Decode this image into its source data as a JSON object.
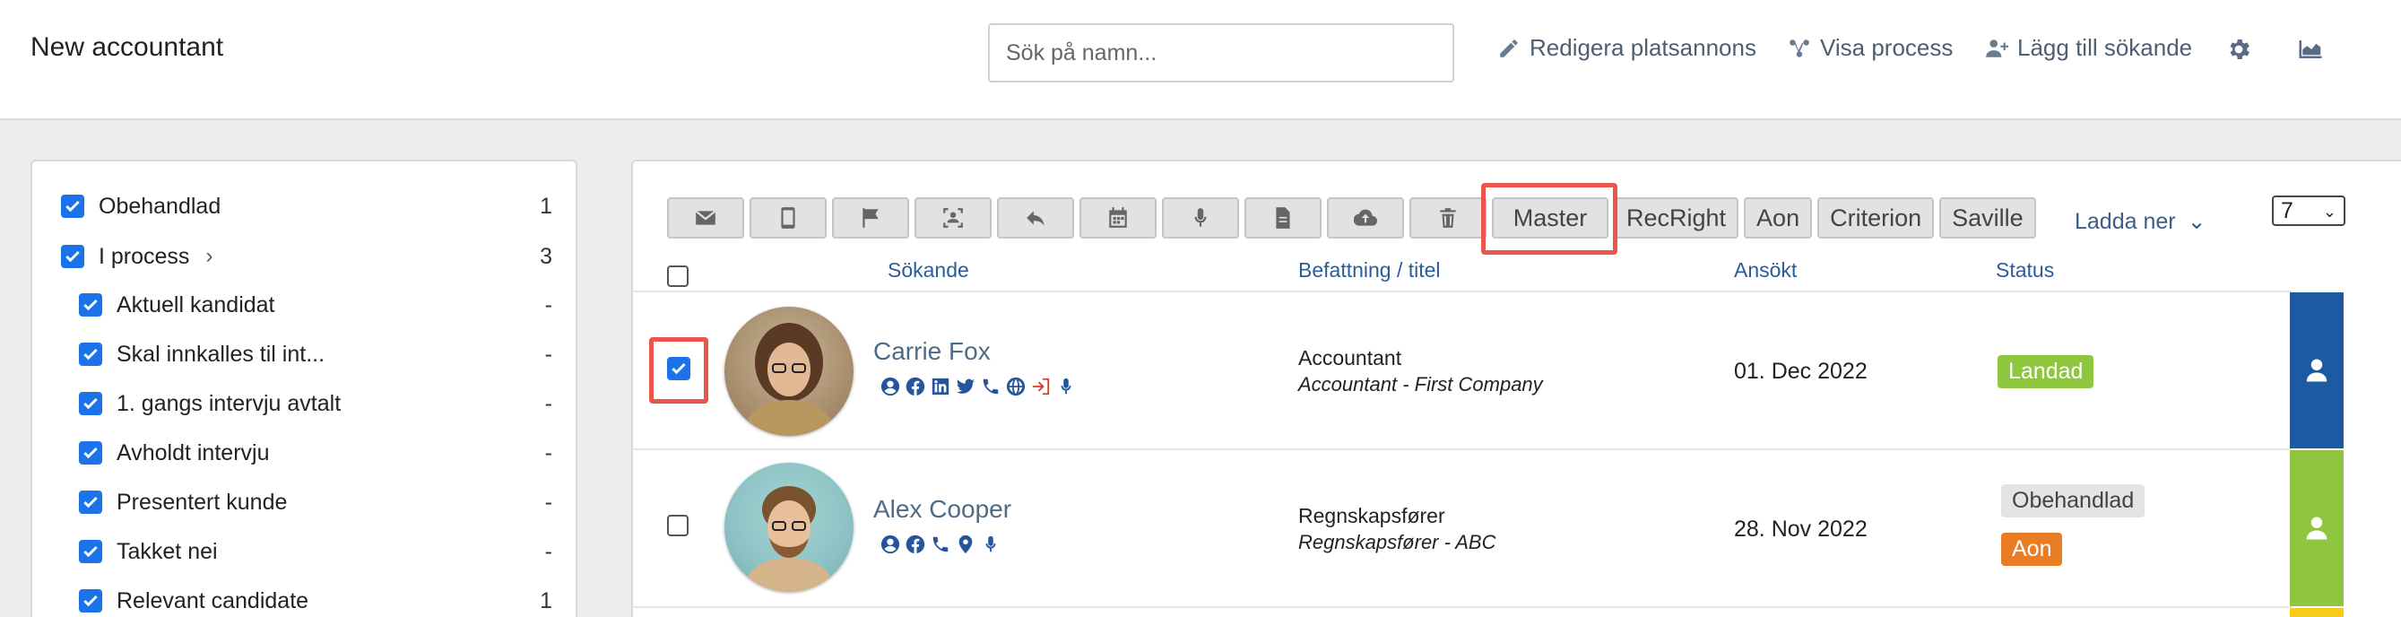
{
  "header": {
    "title": "New accountant",
    "search_placeholder": "Sök på namn...",
    "links": {
      "edit_ad": "Redigera platsannons",
      "show_process": "Visa process",
      "add_applicant": "Lägg till sökande"
    },
    "icons": [
      "pencil-icon",
      "process-icon",
      "add-user-icon",
      "gear-icon",
      "chart-icon"
    ]
  },
  "filters": [
    {
      "label": "Obehandlad",
      "count": "1",
      "checked": true,
      "level": 0
    },
    {
      "label": "I process",
      "count": "3",
      "checked": true,
      "level": 0,
      "expandable": true
    },
    {
      "label": "Aktuell kandidat",
      "count": "-",
      "checked": true,
      "level": 1
    },
    {
      "label": "Skal innkalles til int...",
      "count": "-",
      "checked": true,
      "level": 1
    },
    {
      "label": "1. gangs intervju avtalt",
      "count": "-",
      "checked": true,
      "level": 1
    },
    {
      "label": "Avholdt intervju",
      "count": "-",
      "checked": true,
      "level": 1
    },
    {
      "label": "Presentert kunde",
      "count": "-",
      "checked": true,
      "level": 1
    },
    {
      "label": "Takket nei",
      "count": "-",
      "checked": true,
      "level": 1
    },
    {
      "label": "Relevant candidate",
      "count": "1",
      "checked": true,
      "level": 1
    }
  ],
  "toolbar": {
    "icon_buttons": [
      "mail-icon",
      "mobile-icon",
      "flag-icon",
      "scan-face-icon",
      "reply-icon",
      "calendar-icon",
      "microphone-icon",
      "document-icon",
      "cloud-upload-icon",
      "trash-icon"
    ],
    "text_buttons": [
      "Master",
      "RecRight",
      "Aon",
      "Criterion",
      "Saville"
    ],
    "download_label": "Ladda ner",
    "page_size": "7"
  },
  "columns": {
    "applicant": "Sökande",
    "position": "Befattning / titel",
    "applied": "Ansökt",
    "status": "Status"
  },
  "candidates": [
    {
      "name": "Carrie Fox",
      "selected": true,
      "title": "Accountant",
      "subtitle": "Accountant - First Company",
      "date": "01. Dec 2022",
      "status": [
        {
          "label": "Landad",
          "color": "#8fc63f",
          "text_color": "#ffffff"
        }
      ],
      "side_color": "#1d5aa1",
      "icons": [
        "user-circle-icon",
        "facebook-icon",
        "linkedin-icon",
        "twitter-icon",
        "phone-icon",
        "globe-icon",
        "login-icon",
        "microphone-icon"
      ]
    },
    {
      "name": "Alex Cooper",
      "selected": false,
      "title": "Regnskapsfører",
      "subtitle": "Regnskapsfører  - ABC",
      "date": "28. Nov 2022",
      "status": [
        {
          "label": "Obehandlad",
          "color": "#e4e4e4",
          "text_color": "#444444"
        },
        {
          "label": "Aon",
          "color": "#e87d24",
          "text_color": "#ffffff"
        }
      ],
      "side_color": "#8fc63f",
      "icons": [
        "user-circle-icon",
        "facebook-icon",
        "phone-icon",
        "location-icon",
        "microphone-icon"
      ]
    }
  ],
  "colors": {
    "accent": "#1a73e8",
    "link": "#2a5d9a",
    "highlight": "#e8564c",
    "third_row_side": "#f5cc1a"
  }
}
